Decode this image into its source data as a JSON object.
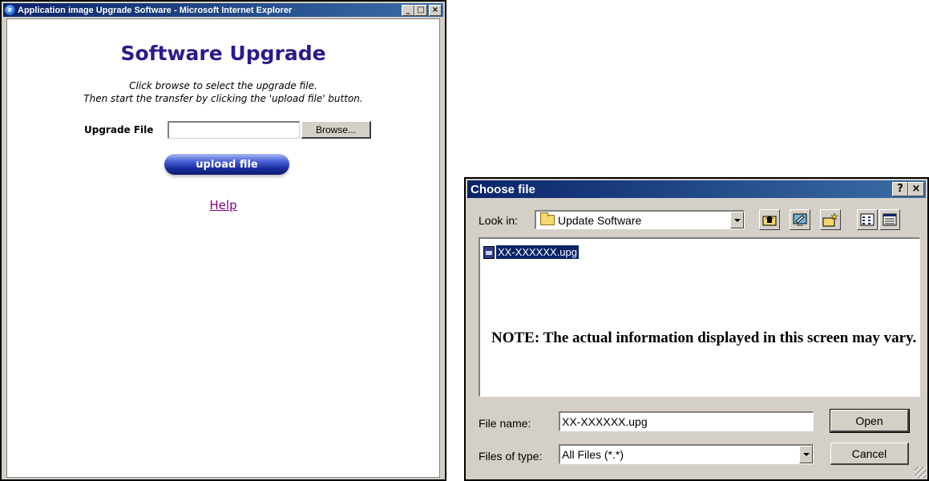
{
  "ie_window": {
    "title": "Application image Upgrade Software - Microsoft Internet Explorer",
    "controls": {
      "minimize": "_",
      "maximize": "□",
      "close": "×"
    },
    "page": {
      "heading": "Software Upgrade",
      "instruction_1": "Click browse to select the upgrade file.",
      "instruction_2": "Then start the transfer by clicking the 'upload file' button.",
      "upgrade_label": "Upgrade File",
      "upgrade_value": "",
      "browse_label": "Browse...",
      "upload_label": "upload file",
      "help_label": "Help"
    }
  },
  "dialog": {
    "title": "Choose file",
    "help_btn": "?",
    "close_btn": "×",
    "look_in_label": "Look in:",
    "look_in_value": "Update Software",
    "toolbar_icons": [
      "up-one-level-icon",
      "desktop-icon",
      "new-folder-icon",
      "list-view-icon",
      "details-view-icon"
    ],
    "files": [
      {
        "name": "XX-XXXXXX.upg",
        "selected": true
      }
    ],
    "note": "NOTE: The actual information displayed in this screen may vary.",
    "file_name_label": "File name:",
    "file_name_value": "XX-XXXXXX.upg",
    "files_of_type_label": "Files of type:",
    "files_of_type_value": "All Files (*.*)",
    "open_label": "Open",
    "cancel_label": "Cancel"
  },
  "colors": {
    "titlebar": "#0a246a",
    "heading": "#2a1a8c",
    "link_visited": "#800080",
    "selection": "#0a246a",
    "button_face": "#d4d0c8"
  }
}
